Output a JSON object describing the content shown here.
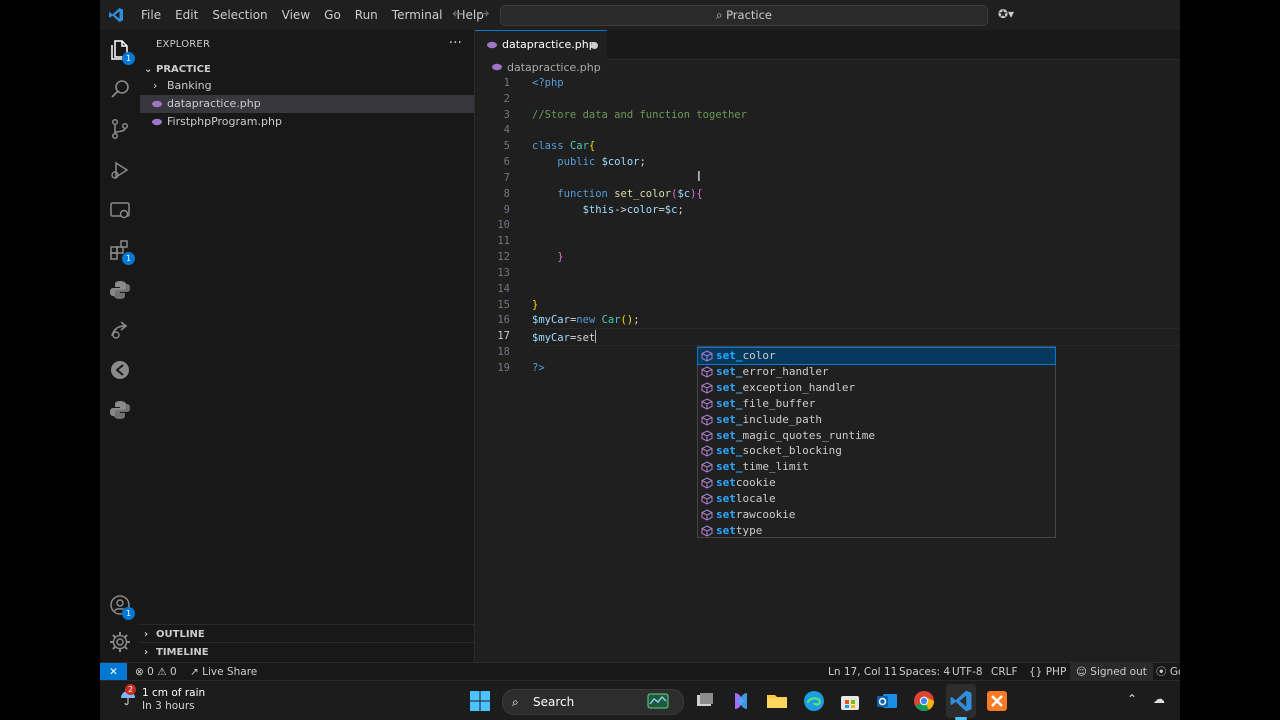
{
  "window": {
    "menu": [
      "File",
      "Edit",
      "Selection",
      "View",
      "Go",
      "Run",
      "Terminal",
      "Help"
    ],
    "search_text": "Practice",
    "nav_back_icon": "arrow-left-icon",
    "nav_forward_icon": "arrow-right-icon"
  },
  "activity_bar": {
    "explorer_badge": "1",
    "extensions_badge": "1",
    "accounts_badge": "1"
  },
  "sidebar": {
    "title": "EXPLORER",
    "more": "···",
    "folder": "PRACTICE",
    "items": [
      {
        "label": "Banking",
        "type": "folder"
      },
      {
        "label": "datapractice.php",
        "type": "php"
      },
      {
        "label": "FirstphpProgram.php",
        "type": "php"
      }
    ],
    "outline": "OUTLINE",
    "timeline": "TIMELINE"
  },
  "editor": {
    "tab": "datapractice.php",
    "breadcrumb": "datapractice.php",
    "line_numbers": [
      "1",
      "2",
      "3",
      "4",
      "5",
      "6",
      "7",
      "8",
      "9",
      "10",
      "11",
      "12",
      "13",
      "14",
      "15",
      "16",
      "17",
      "18",
      "19"
    ],
    "code": {
      "l1": "<?php",
      "l3": "//Store data and function together",
      "l5_kw": "class",
      "l5_cls": "Car",
      "l5_br": "{",
      "l6_kw": "public",
      "l6_var": "$color",
      "l6_end": ";",
      "l8_kw": "function",
      "l8_fn": "set_color",
      "l8_open": "(",
      "l8_arg": "$c",
      "l8_close": ")",
      "l8_br": "{",
      "l9_this": "$this",
      "l9_arrow": "->",
      "l9_prop": "color",
      "l9_eq": "=",
      "l9_val": "$c",
      "l9_end": ";",
      "l12_br": "}",
      "l15_br": "}",
      "l16_var": "$myCar",
      "l16_eq": "=",
      "l16_new": "new",
      "l16_cls": "Car",
      "l16_paren": "()",
      "l16_end": ";",
      "l17_var": "$myCar",
      "l17_eq": "=",
      "l17_typed": "set",
      "l19": "?>"
    },
    "suggestions": [
      {
        "match": "set_",
        "rest": "color"
      },
      {
        "match": "set_",
        "rest": "error_handler"
      },
      {
        "match": "set_",
        "rest": "exception_handler"
      },
      {
        "match": "set_",
        "rest": "file_buffer"
      },
      {
        "match": "set_",
        "rest": "include_path"
      },
      {
        "match": "set_",
        "rest": "magic_quotes_runtime"
      },
      {
        "match": "set_",
        "rest": "socket_blocking"
      },
      {
        "match": "set_",
        "rest": "time_limit"
      },
      {
        "match": "set",
        "rest": "cookie"
      },
      {
        "match": "set",
        "rest": "locale"
      },
      {
        "match": "set",
        "rest": "rawcookie"
      },
      {
        "match": "set",
        "rest": "type"
      }
    ]
  },
  "statusbar": {
    "errors": "0",
    "warnings": "0",
    "live_share": "Live Share",
    "position": "Ln 17, Col 11",
    "spaces": "Spaces: 4",
    "encoding": "UTF-8",
    "eol": "CRLF",
    "language": "PHP",
    "signed": "Signed out",
    "go": "Go"
  },
  "taskbar": {
    "weather_title": "1 cm of rain",
    "weather_sub": "In 3 hours",
    "weather_badge": "2",
    "search": "Search"
  },
  "colors": {
    "accent": "#0078d4",
    "php_icon": "#a074c4",
    "keyword": "#569cd6",
    "comment": "#6a9955",
    "function": "#dcdcaa",
    "variable": "#9cdcfe",
    "class": "#4ec9b0",
    "match_highlight": "#2aaaff"
  }
}
